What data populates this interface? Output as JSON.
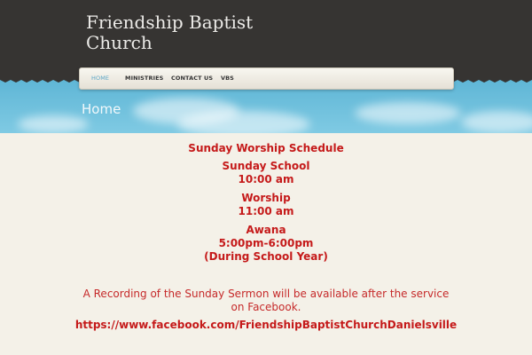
{
  "site": {
    "title": "Friendship Baptist Church"
  },
  "nav": {
    "items": [
      {
        "label": "HOME",
        "active": true
      },
      {
        "label": "MINISTRIES",
        "active": false
      },
      {
        "label": "CONTACT US",
        "active": false
      },
      {
        "label": "VBS",
        "active": false
      }
    ]
  },
  "page": {
    "heading": "Home"
  },
  "content": {
    "schedule_title": "Sunday Worship Schedule",
    "sunday_school": {
      "label": "Sunday School",
      "time": "10:00 am"
    },
    "worship": {
      "label": "Worship",
      "time": "11:00 am"
    },
    "awana": {
      "label": "Awana",
      "time": "5:00pm-6:00pm",
      "note": "(During School Year)"
    },
    "recording_notice": "A Recording of the Sunday Sermon will be available after the service on Facebook.",
    "facebook_link": "https://www.facebook.com/FriendshipBaptistChurchDanielsville"
  },
  "colors": {
    "header_bg": "#363432",
    "accent_red": "#c51a1a",
    "nav_active": "#5ba6c6",
    "sky": "#6cc0dc"
  }
}
